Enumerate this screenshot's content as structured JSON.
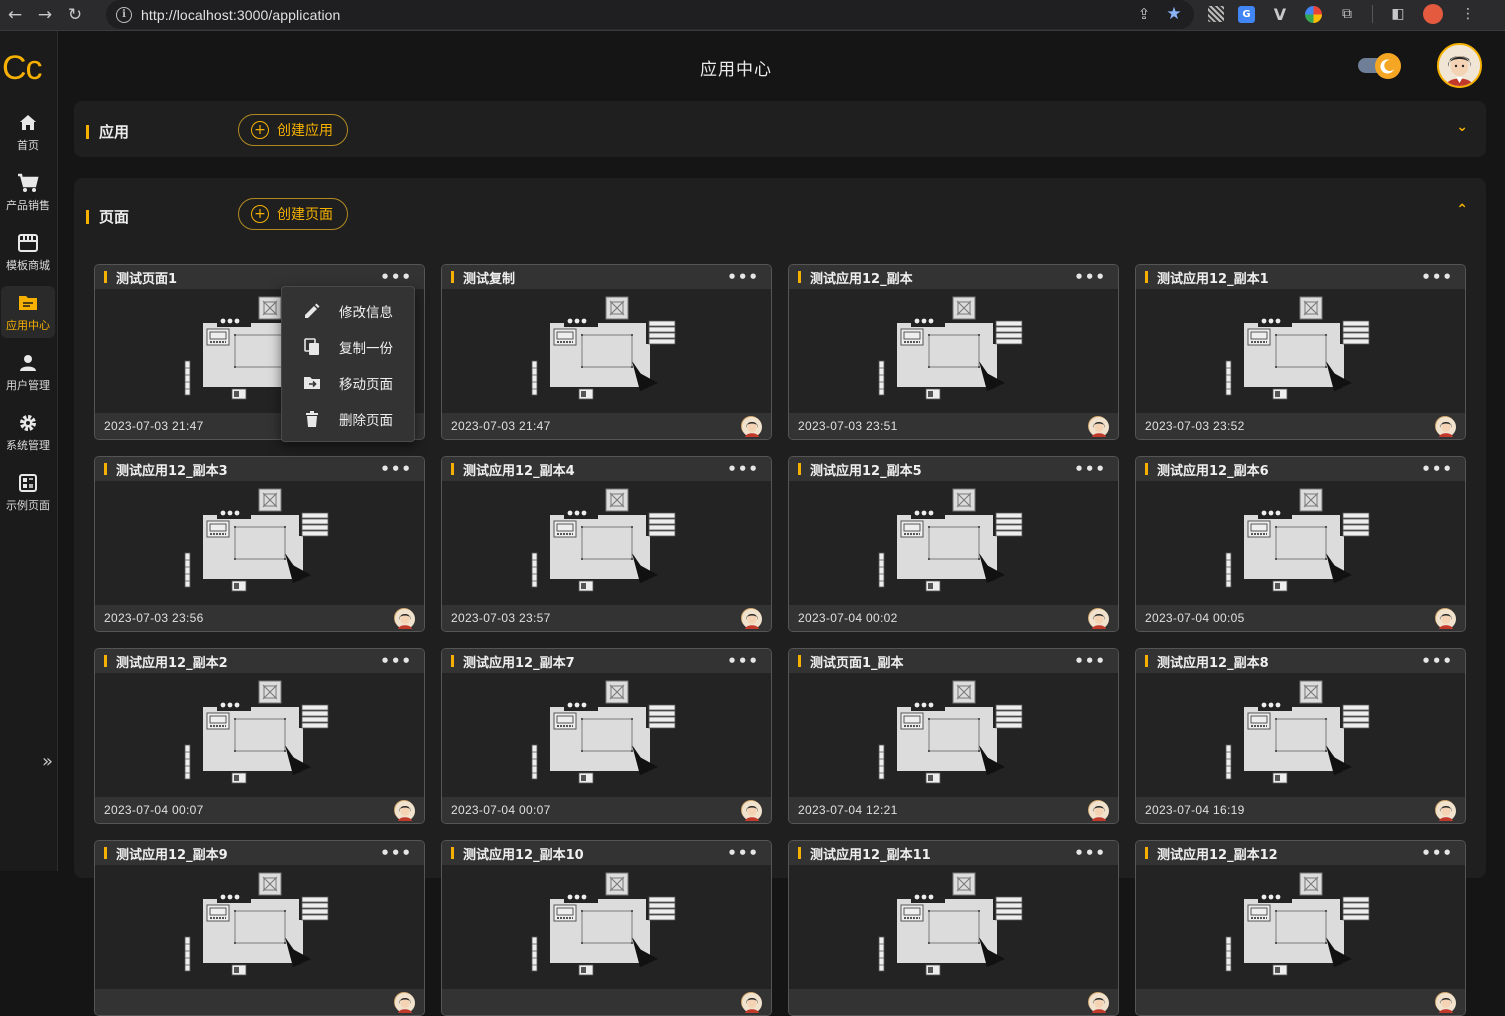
{
  "browser": {
    "url": "http://localhost:3000/application"
  },
  "sidebar": {
    "logo": "Cc",
    "items": [
      {
        "label": "首页",
        "icon": "home-icon"
      },
      {
        "label": "产品销售",
        "icon": "cart-icon"
      },
      {
        "label": "模板商城",
        "icon": "store-icon"
      },
      {
        "label": "应用中心",
        "icon": "folder-icon"
      },
      {
        "label": "用户管理",
        "icon": "user-icon"
      },
      {
        "label": "系统管理",
        "icon": "gear-icon"
      },
      {
        "label": "示例页面",
        "icon": "dashboard-icon"
      }
    ],
    "active_item": "应用中心"
  },
  "header": {
    "title": "应用中心",
    "theme_toggle": "dark"
  },
  "apps_section": {
    "title": "应用",
    "create_label": "创建应用",
    "expanded": false
  },
  "pages_section": {
    "title": "页面",
    "create_label": "创建页面",
    "expanded": true,
    "cards": [
      {
        "title": "测试页面1",
        "date": "2023-07-03 21:47"
      },
      {
        "title": "测试复制",
        "date": "2023-07-03 21:47"
      },
      {
        "title": "测试应用12_副本",
        "date": "2023-07-03 23:51"
      },
      {
        "title": "测试应用12_副本1",
        "date": "2023-07-03 23:52"
      },
      {
        "title": "测试应用12_副本3",
        "date": "2023-07-03 23:56"
      },
      {
        "title": "测试应用12_副本4",
        "date": "2023-07-03 23:57"
      },
      {
        "title": "测试应用12_副本5",
        "date": "2023-07-04 00:02"
      },
      {
        "title": "测试应用12_副本6",
        "date": "2023-07-04 00:05"
      },
      {
        "title": "测试应用12_副本2",
        "date": "2023-07-04 00:07"
      },
      {
        "title": "测试应用12_副本7",
        "date": "2023-07-04 00:07"
      },
      {
        "title": "测试页面1_副本",
        "date": "2023-07-04 12:21"
      },
      {
        "title": "测试应用12_副本8",
        "date": "2023-07-04 16:19"
      },
      {
        "title": "测试应用12_副本9",
        "date": ""
      },
      {
        "title": "测试应用12_副本10",
        "date": ""
      },
      {
        "title": "测试应用12_副本11",
        "date": ""
      },
      {
        "title": "测试应用12_副本12",
        "date": ""
      }
    ]
  },
  "context_menu": {
    "items": [
      {
        "label": "修改信息",
        "icon": "edit-icon"
      },
      {
        "label": "复制一份",
        "icon": "copy-icon"
      },
      {
        "label": "移动页面",
        "icon": "move-folder-icon"
      },
      {
        "label": "删除页面",
        "icon": "trash-icon"
      }
    ]
  }
}
